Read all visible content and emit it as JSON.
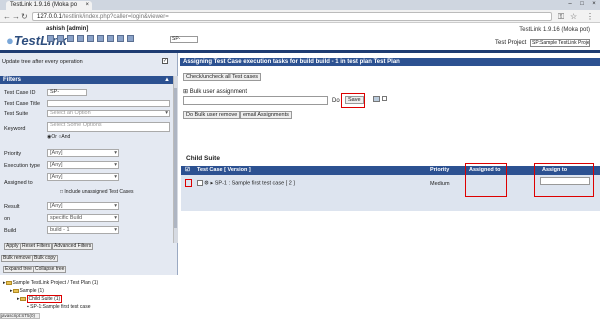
{
  "browser": {
    "tab_title": "TestLink 1.9.16 (Moka po",
    "url_host": "127.0.0.1",
    "url_path": "/testlink/index.php?caller=login&viewer="
  },
  "header": {
    "logo_text": "TestLink",
    "user": "ashish [admin]",
    "search_value": "SP-",
    "version": "TestLink 1.9.16 (Moka pot)",
    "project_label": "Test Project",
    "project_value": "SP:Sample TestLink Project"
  },
  "left": {
    "update_tree_label": "Update tree after every operation",
    "filters_title": "Filters",
    "fields": {
      "tcid_label": "Test Case ID",
      "tcid_value": "SP-",
      "title_label": "Test Case Title",
      "suite_label": "Test Suite",
      "suite_placeholder": "Select an Option",
      "keyword_label": "Keyword",
      "keyword_placeholder": "Select Some Options",
      "or_label": "Or",
      "and_label": "And",
      "priority_label": "Priority",
      "priority_value": "[Any]",
      "exec_type_label": "Execution type",
      "exec_type_value": "[Any]",
      "assigned_label": "Assigned to",
      "assigned_value": "[Any]",
      "include_unassigned": "Include unassigned Test Cases",
      "result_label": "Result",
      "result_value": "[Any]",
      "on_label": "on",
      "on_value": "specific Build",
      "build_label": "Build",
      "build_value": "build - 1"
    },
    "buttons": {
      "apply": "Apply",
      "reset": "Reset Filters",
      "advanced": "Advanced Filters",
      "bulk_remove": "Bulk remove",
      "bulk_copy": "Bulk copy",
      "expand": "Expand tree",
      "collapse": "Collapse tree"
    },
    "tree": {
      "root": "Sample TestLink Project / Test Plan (1)",
      "sample": "Sample (1)",
      "child": "Child Suite (1)",
      "tc": "SP-1:Sample first test case"
    },
    "status": "javascript:ST5(0)"
  },
  "main": {
    "title": "Assigning Test Case execution tasks for build build - 1 in test plan Test Plan",
    "check_btn": "Check/uncheck all Test cases",
    "bulk_label": "Bulk user assignment",
    "do_label": "Do",
    "save_btn": "Save",
    "do_bulk_remove": "Do Bulk user remove",
    "email_btn": "email Assignments",
    "suite_title": "Child Suite",
    "cols": {
      "tc": "Test Case [ Version ]",
      "priority": "Priority",
      "assigned": "Assigned to",
      "assign_to": "Assign to"
    },
    "row": {
      "tc": "SP-1 : Sample first test case  [ 2 ]",
      "priority": "Medium"
    }
  },
  "colors": {
    "dark_blue": "#1e3c72",
    "bar_blue": "#2c5191",
    "highlight": "#dd0000"
  }
}
